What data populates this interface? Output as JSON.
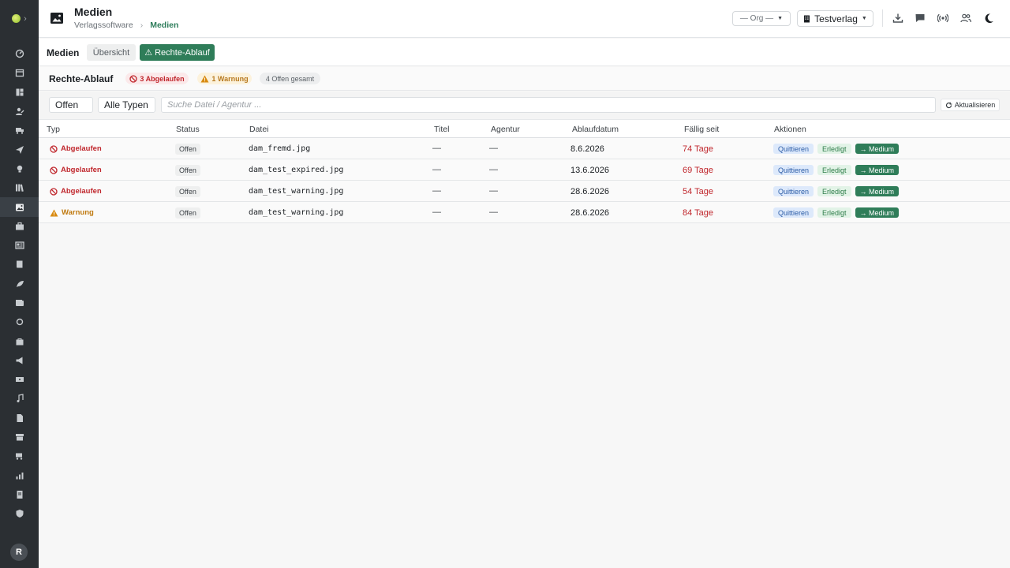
{
  "header": {
    "title": "Medien",
    "breadcrumb": [
      "Verlagssoftware",
      "Medien"
    ],
    "org_select": "— Org —",
    "verlag_select": "Testverlag"
  },
  "tabs": {
    "section": "Medien",
    "items": [
      "Übersicht",
      "⚠ Rechte-Ablauf"
    ]
  },
  "summary": {
    "title": "Rechte-Ablauf",
    "expired": "3 Abgelaufen",
    "warnings": "1 Warnung",
    "open_total": "4 Offen gesamt"
  },
  "filters": {
    "status": "Offen",
    "type": "Alle Typen",
    "search_placeholder": "Suche Datei / Agentur ...",
    "refresh": "Aktualisieren"
  },
  "table": {
    "columns": [
      "Typ",
      "Status",
      "Datei",
      "Titel",
      "Agentur",
      "Ablaufdatum",
      "Fällig seit",
      "Aktionen"
    ],
    "actions": [
      "Quittieren",
      "Erledigt",
      "→ Medium"
    ],
    "rows": [
      {
        "typ": "Abgelaufen",
        "status": "Offen",
        "datei": "dam_fremd.jpg",
        "titel": "—",
        "agentur": "—",
        "ablauf": "8.6.2026",
        "faellig": "74 Tage"
      },
      {
        "typ": "Abgelaufen",
        "status": "Offen",
        "datei": "dam_test_expired.jpg",
        "titel": "—",
        "agentur": "—",
        "ablauf": "13.6.2026",
        "faellig": "69 Tage"
      },
      {
        "typ": "Abgelaufen",
        "status": "Offen",
        "datei": "dam_test_warning.jpg",
        "titel": "—",
        "agentur": "—",
        "ablauf": "28.6.2026",
        "faellig": "54 Tage"
      },
      {
        "typ": "Warnung",
        "status": "Offen",
        "datei": "dam_test_warning.jpg",
        "titel": "—",
        "agentur": "—",
        "ablauf": "28.6.2026",
        "faellig": "84 Tage"
      }
    ]
  },
  "user": {
    "initial": "R"
  },
  "colors": {
    "accent": "#2f7d59",
    "danger": "#c0272d",
    "warning": "#c07a10",
    "sidebar": "#2b2f33"
  }
}
